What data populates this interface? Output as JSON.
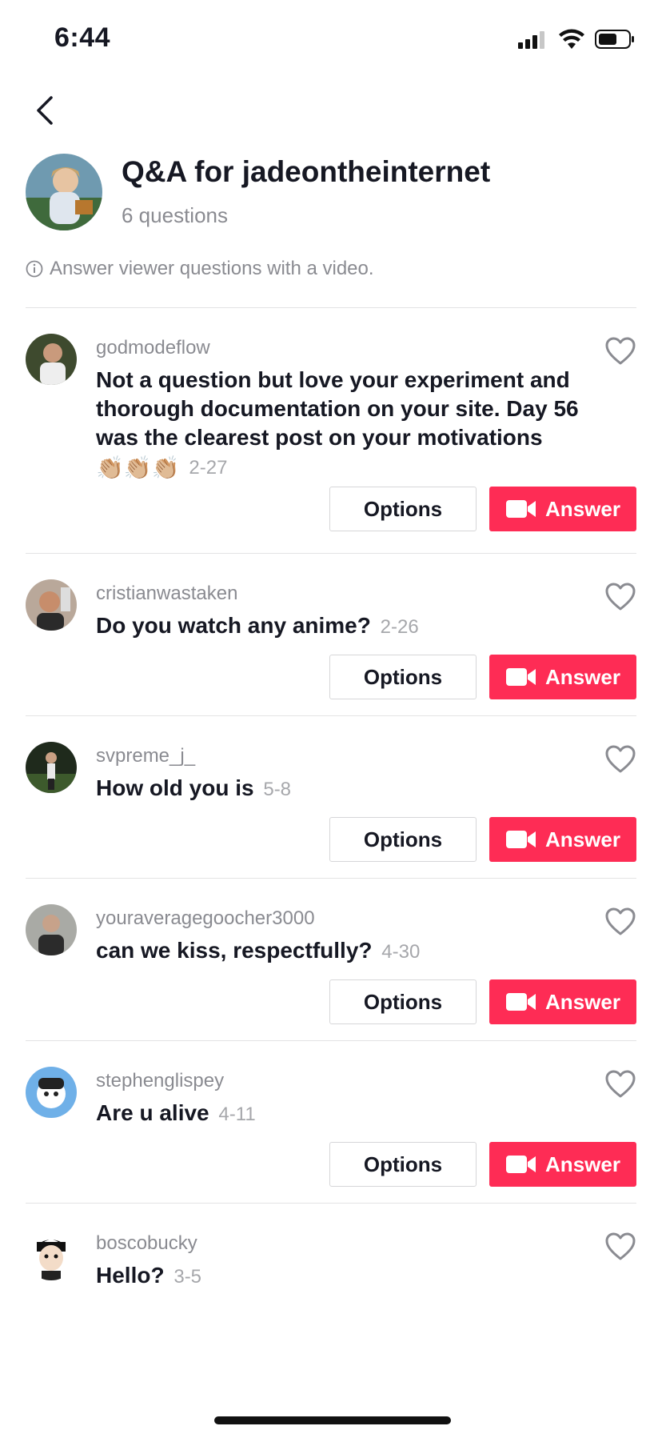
{
  "status_bar": {
    "time": "6:44"
  },
  "header": {
    "title": "Q&A for jadeontheinternet",
    "subtitle": "6 questions"
  },
  "info": {
    "text": "Answer viewer questions with a video."
  },
  "buttons": {
    "options": "Options",
    "answer": "Answer"
  },
  "questions": [
    {
      "user": "godmodeflow",
      "text": "Not a question but love your experiment and thorough documentation on your site. Day 56 was the clearest post on your motivations",
      "emoji": "👏🏼👏🏼👏🏼",
      "date": "2-27"
    },
    {
      "user": "cristianwastaken",
      "text": "Do you watch any anime?",
      "date": "2-26"
    },
    {
      "user": "svpreme_j_",
      "text": "How old you is",
      "date": "5-8"
    },
    {
      "user": "youraveragegoocher3000",
      "text": "can we kiss, respectfully?",
      "date": "4-30"
    },
    {
      "user": "stephenglispey",
      "text": "Are u alive",
      "date": "4-11"
    },
    {
      "user": "boscobucky",
      "text": "Hello?",
      "date": "3-5"
    }
  ],
  "colors": {
    "accent": "#fe2c55",
    "muted": "#8a8b91",
    "text": "#161823"
  },
  "icons": [
    "back-icon",
    "heart-icon",
    "video-camera-icon",
    "info-icon",
    "signal-icon",
    "wifi-icon",
    "battery-icon"
  ]
}
